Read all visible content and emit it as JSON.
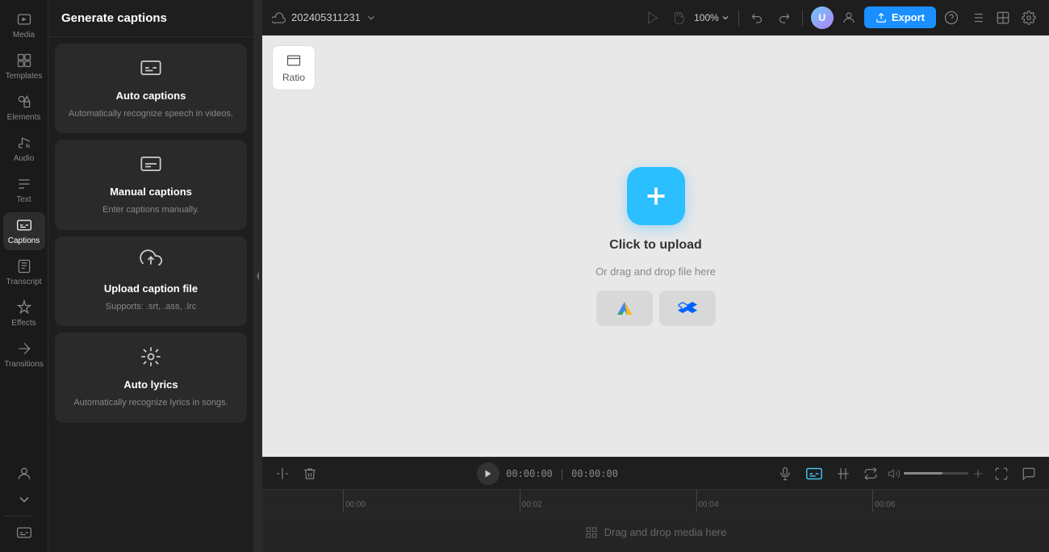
{
  "app": {
    "title": "Generate captions"
  },
  "project": {
    "name": "202405311231",
    "cloud_icon": "☁"
  },
  "toolbar": {
    "zoom_level": "100%",
    "export_label": "Export"
  },
  "sidebar": {
    "items": [
      {
        "id": "media",
        "label": "Media",
        "icon": "media"
      },
      {
        "id": "templates",
        "label": "Templates",
        "icon": "templates"
      },
      {
        "id": "elements",
        "label": "Elements",
        "icon": "elements"
      },
      {
        "id": "audio",
        "label": "Audio",
        "icon": "audio"
      },
      {
        "id": "text",
        "label": "Text",
        "icon": "text"
      },
      {
        "id": "captions",
        "label": "Captions",
        "icon": "captions"
      },
      {
        "id": "transcript",
        "label": "Transcript",
        "icon": "transcript"
      },
      {
        "id": "effects",
        "label": "Effects",
        "icon": "effects"
      },
      {
        "id": "transitions",
        "label": "Transitions",
        "icon": "transitions"
      }
    ]
  },
  "panel": {
    "title": "Generate captions",
    "cards": [
      {
        "id": "auto-captions",
        "title": "Auto captions",
        "desc": "Automatically recognize speech in videos."
      },
      {
        "id": "manual-captions",
        "title": "Manual captions",
        "desc": "Enter captions manually."
      },
      {
        "id": "upload-caption",
        "title": "Upload caption file",
        "desc": "Supports: .srt, .ass, .lrc"
      },
      {
        "id": "auto-lyrics",
        "title": "Auto lyrics",
        "desc": "Automatically recognize lyrics in songs."
      }
    ]
  },
  "canvas": {
    "ratio_label": "Ratio",
    "upload_title": "Click to upload",
    "upload_subtitle": "Or drag and drop file here"
  },
  "timeline": {
    "current_time": "00:00:00",
    "total_time": "00:00:00",
    "markers": [
      "00:00",
      "00:02",
      "00:04",
      "00:06"
    ],
    "drop_label": "Drag and drop media here"
  }
}
